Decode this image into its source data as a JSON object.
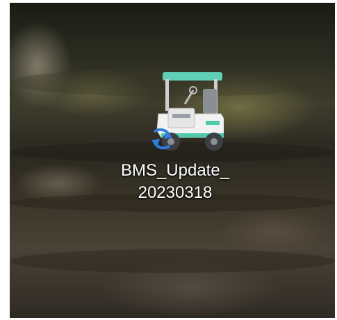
{
  "desktop": {
    "icons": [
      {
        "name": "golf-cart-app-icon",
        "overlay": "sync-arrows-icon",
        "label_line1": "BMS_Update_",
        "label_line2": "20230318"
      }
    ]
  },
  "colors": {
    "cart_roof": "#5fd0b8",
    "cart_body": "#f2f2f2",
    "cart_trim": "#4ecaa8",
    "sync_arrows": "#2e7de0",
    "label_text": "#ffffff"
  }
}
